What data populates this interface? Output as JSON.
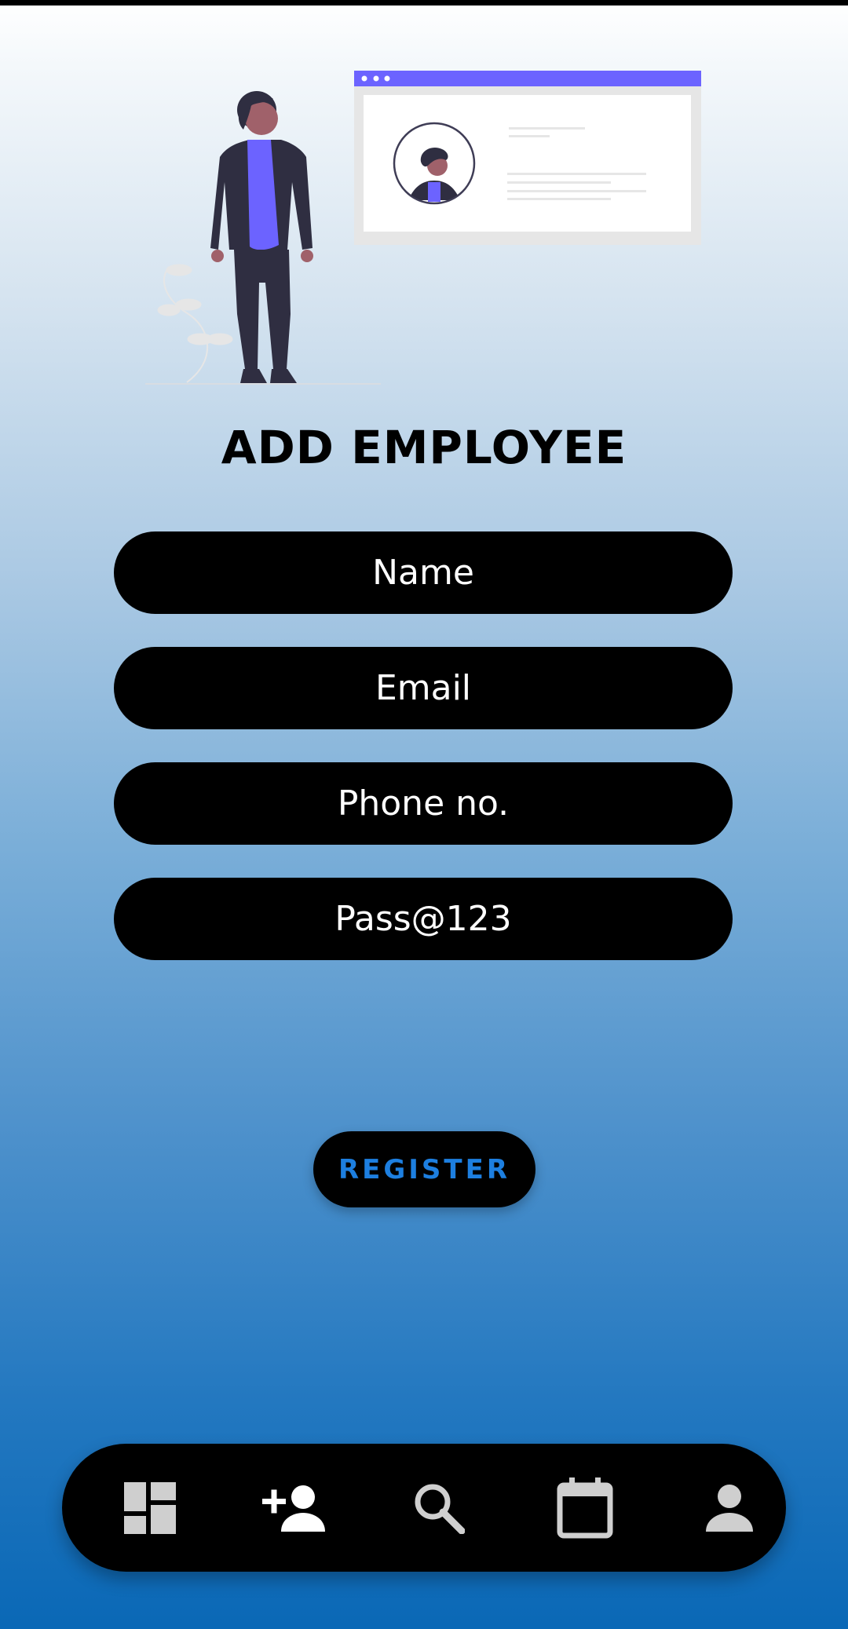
{
  "header": {
    "title": "ADD EMPLOYEE"
  },
  "form": {
    "fields": [
      {
        "name": "name",
        "placeholder": "Name",
        "value": ""
      },
      {
        "name": "email",
        "placeholder": "Email",
        "value": ""
      },
      {
        "name": "phone",
        "placeholder": "Phone no.",
        "value": ""
      },
      {
        "name": "password",
        "placeholder": "",
        "value": "Pass@123"
      }
    ],
    "submit_label": "REGISTER"
  },
  "bottom_nav": {
    "items": [
      {
        "icon": "dashboard-icon"
      },
      {
        "icon": "add-person-icon"
      },
      {
        "icon": "search-icon"
      },
      {
        "icon": "calendar-icon"
      },
      {
        "icon": "person-icon"
      }
    ]
  },
  "colors": {
    "accent": "#6c63ff",
    "button_text": "#1d7fe0",
    "background_top": "#ffffff",
    "background_bottom": "#0a68b6"
  }
}
